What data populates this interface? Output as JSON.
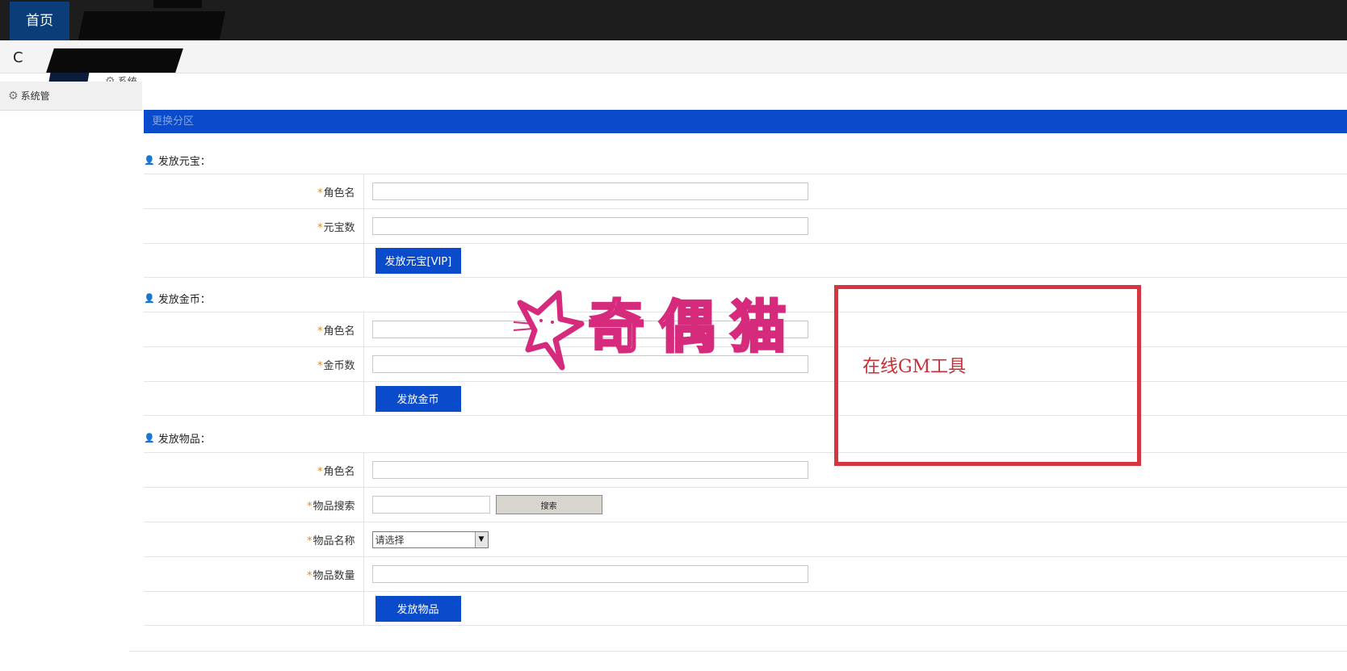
{
  "topbar": {
    "home_tab": "首页"
  },
  "tabs": {
    "system_tab": "系统",
    "side_tab": "系统管"
  },
  "zone_bar": {
    "label": "更换分区"
  },
  "sections": {
    "yuanbao": {
      "title": "发放元宝：",
      "role_label": "角色名",
      "amount_label": "元宝数",
      "button": "发放元宝[VIP]"
    },
    "gold": {
      "title": "发放金币：",
      "role_label": "角色名",
      "amount_label": "金币数",
      "button": "发放金币"
    },
    "item": {
      "title": "发放物品：",
      "role_label": "角色名",
      "search_label": "物品搜索",
      "search_button": "搜索",
      "name_label": "物品名称",
      "name_select_value": "请选择",
      "qty_label": "物品数量",
      "button": "发放物品"
    }
  },
  "watermark": {
    "text": "奇偶猫"
  },
  "annotation": {
    "text": "在线GM工具"
  },
  "colors": {
    "topbar": "#1d1d1d",
    "home_tab": "#0b3d78",
    "accent_blue": "#0a4bcc",
    "required": "#e08a1e",
    "annotation_red": "#d6363f",
    "watermark_pink": "#d62a7d"
  },
  "icons": [
    "refresh-icon",
    "gear-icon",
    "user-icon",
    "dropdown-arrow-icon",
    "cat-logo-icon"
  ]
}
